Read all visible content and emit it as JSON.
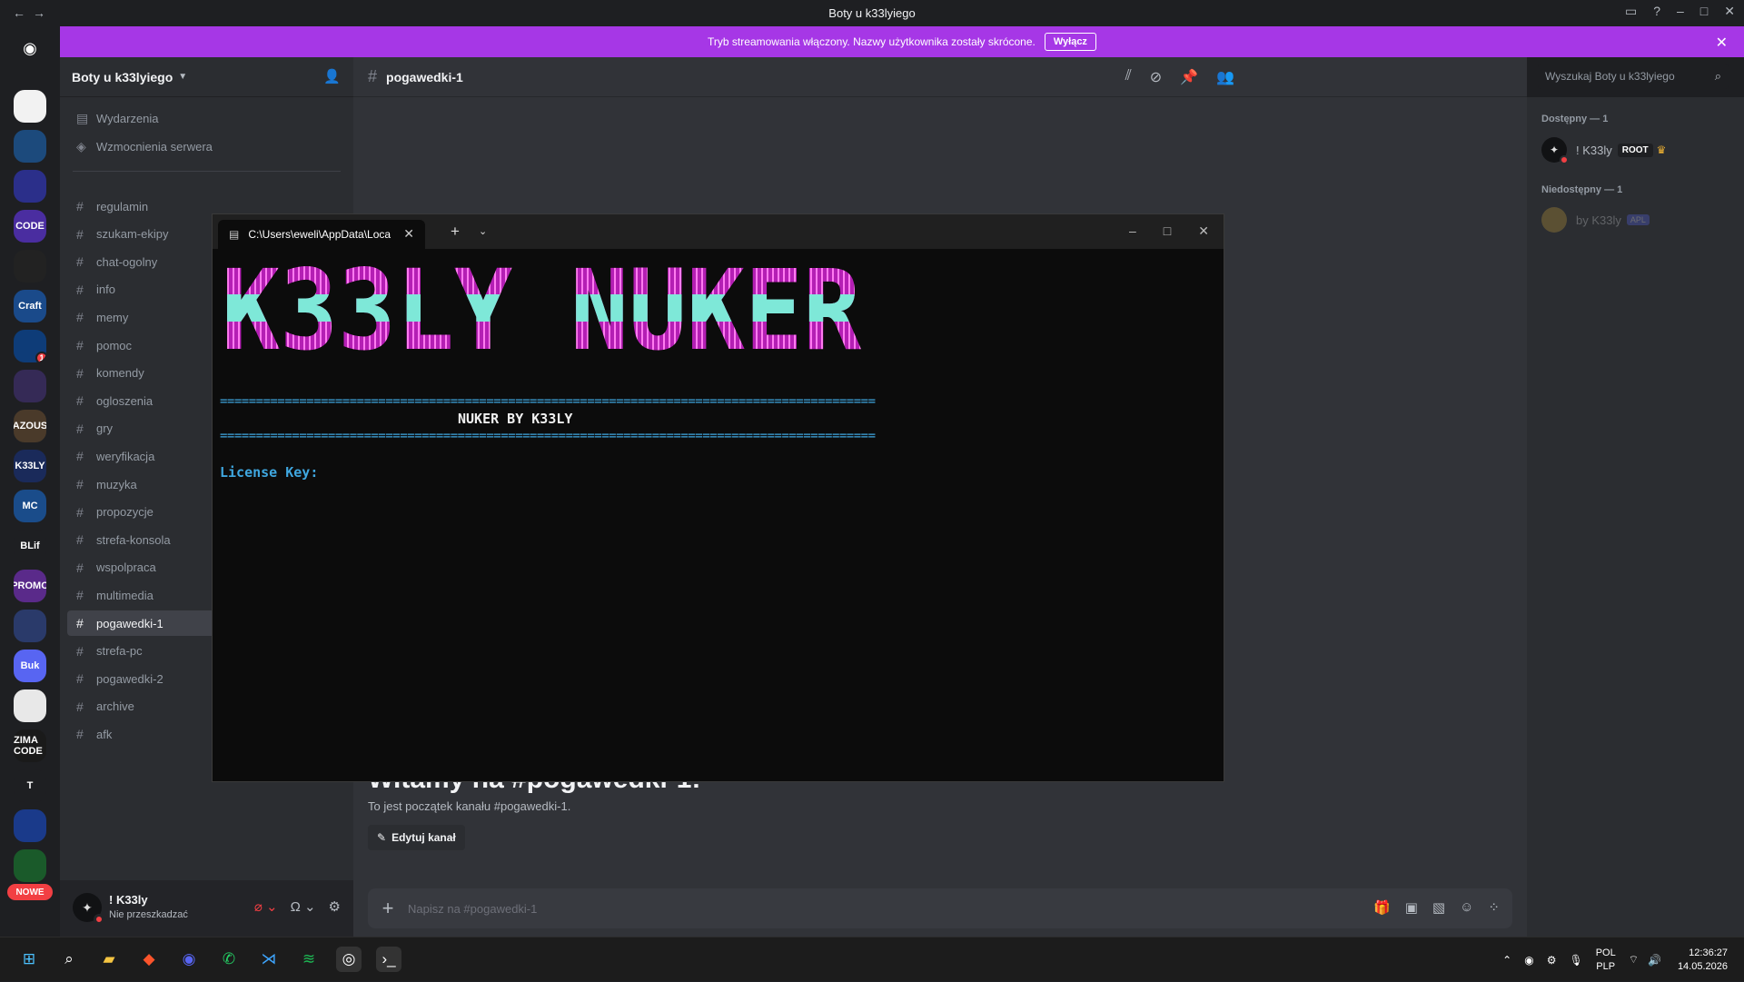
{
  "titlebar": {
    "title": "Boty u k33lyiego"
  },
  "banner": {
    "text": "Tryb streamowania włączony. Nazwy użytkownika zostały skrócone.",
    "button": "Wyłącz"
  },
  "colors": {
    "banner": "#a637e6",
    "accent_blue": "#3fa7e0",
    "magenta": "#b41fb4",
    "cyan": "#7ee8d8",
    "dnd": "#f23f43"
  },
  "guilds": {
    "new_badge": "NOWE",
    "items": [
      {
        "label": "",
        "color": "#f2f2f2"
      },
      {
        "label": "",
        "color": "#1c4a7c"
      },
      {
        "label": "",
        "color": "#2b2f8a"
      },
      {
        "label": "CODE",
        "color": "#4a2da0"
      },
      {
        "label": "",
        "color": "#222"
      },
      {
        "label": "Craft",
        "color": "#1a4a8a"
      },
      {
        "label": "",
        "color": "#0e3c78",
        "badge": "1"
      },
      {
        "label": "",
        "color": "#352a56"
      },
      {
        "label": "AZOUS",
        "color": "#4a3a2a"
      },
      {
        "label": "K33LY",
        "color": "#1a2a5a"
      },
      {
        "label": "MC",
        "color": "#1a4c8a"
      },
      {
        "label": "BLif",
        "color": "#1e1f22"
      },
      {
        "label": "PROMO",
        "color": "#5a2a8a"
      },
      {
        "label": "",
        "color": "#2a3a6a"
      },
      {
        "label": "Buk",
        "color": "#5865f2"
      },
      {
        "label": "",
        "color": "#e8e8e8"
      },
      {
        "label": "ZIMA CODE",
        "color": "#1a1a1a"
      },
      {
        "label": "T",
        "color": "#1e1f22"
      },
      {
        "label": "",
        "color": "#1a3a8a"
      },
      {
        "label": "",
        "color": "#1a5a2a"
      }
    ]
  },
  "sidebar": {
    "server_name": "Boty u k33lyiego",
    "top_items": [
      "Wydarzenia",
      "Wzmocnienia serwera"
    ],
    "channels": [
      "regulamin",
      "szukam-ekipy",
      "chat-ogolny",
      "info",
      "memy",
      "pomoc",
      "komendy",
      "ogloszenia",
      "gry",
      "weryfikacja",
      "muzyka",
      "propozycje",
      "strefa-konsola",
      "wspolpraca",
      "multimedia",
      "pogawedki-1",
      "strefa-pc",
      "pogawedki-2",
      "archive",
      "afk"
    ],
    "active_channel": "pogawedki-1"
  },
  "user": {
    "name": "! K33ly",
    "status": "Nie przeszkadzać"
  },
  "channel": {
    "name": "pogawedki-1",
    "search_placeholder": "Wyszukaj Boty u k33lyiego",
    "welcome_title": "Witamy na #pogawedki-1!",
    "welcome_sub": "To jest początek kanału #pogawedki-1.",
    "edit_button": "Edytuj kanał",
    "composer_placeholder": "Napisz na #pogawedki-1"
  },
  "members": {
    "online_header": "Dostępny — 1",
    "offline_header": "Niedostępny — 1",
    "online": {
      "name": "! K33ly",
      "role": "ROOT"
    },
    "offline": {
      "name": "by K33ly",
      "tag": "APL"
    }
  },
  "terminal": {
    "tab_title": "C:\\Users\\eweli\\AppData\\Loca",
    "banner_art": "K33LY NUKER",
    "separator": "===========================================================================================",
    "subtitle": "NUKER BY K33LY",
    "prompt": "License Key:"
  },
  "tray": {
    "lang1": "POL",
    "lang2": "PLP",
    "time": "12:36:27",
    "date": "14.05.2026"
  }
}
